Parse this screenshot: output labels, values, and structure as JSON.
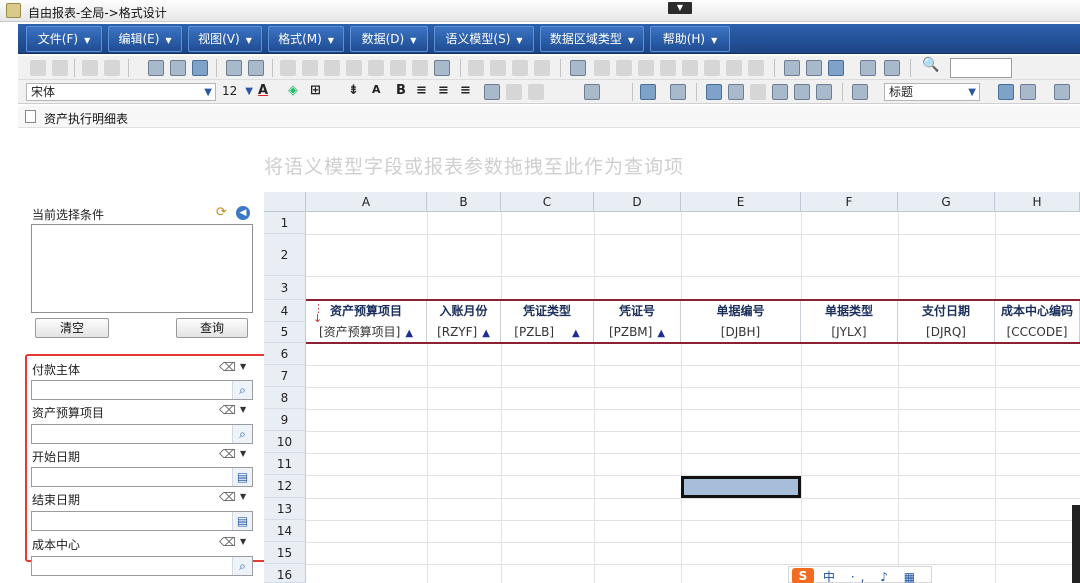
{
  "window": {
    "title": "自由报表-全局->格式设计"
  },
  "menu": [
    {
      "label": "文件(F)"
    },
    {
      "label": "编辑(E)"
    },
    {
      "label": "视图(V)"
    },
    {
      "label": "格式(M)"
    },
    {
      "label": "数据(D)"
    },
    {
      "label": "语义模型(S)"
    },
    {
      "label": "数据区域类型"
    },
    {
      "label": "帮助(H)"
    }
  ],
  "toolbar": {
    "font_name": "宋体",
    "font_size": "12",
    "style_name": "标题"
  },
  "document_tab": {
    "label": "资产执行明细表"
  },
  "drop_hint": "将语义模型字段或报表参数拖拽至此作为查询项",
  "condition_panel": {
    "label": "当前选择条件",
    "clear_button": "清空",
    "query_button": "查询"
  },
  "filters": [
    {
      "label": "付款主体",
      "button": "search-icon"
    },
    {
      "label": "资产预算项目",
      "button": "search-icon"
    },
    {
      "label": "开始日期",
      "button": "calendar-icon"
    },
    {
      "label": "结束日期",
      "button": "calendar-icon"
    },
    {
      "label": "成本中心",
      "button": "search-icon"
    }
  ],
  "sheet": {
    "columns": [
      "A",
      "B",
      "C",
      "D",
      "E",
      "F",
      "G",
      "H"
    ],
    "rows": [
      "1",
      "2",
      "3",
      "4",
      "5",
      "6",
      "7",
      "8",
      "9",
      "10",
      "11",
      "12",
      "13",
      "14",
      "15",
      "16"
    ],
    "header_row": [
      "资产预算项目",
      "入账月份",
      "凭证类型",
      "凭证号",
      "单据编号",
      "单据类型",
      "支付日期",
      "成本中心编码"
    ],
    "field_row": [
      "[资产预算项目]",
      "[RZYF]",
      "[PZLB]",
      "[PZBM]",
      "[DJBH]",
      "[JYLX]",
      "[DJRQ]",
      "[CCCODE]"
    ],
    "field_row_sort_markers": [
      true,
      true,
      true,
      true,
      false,
      false,
      false,
      false
    ],
    "selected_cell": "E12",
    "colors": {
      "band": "#8a2233",
      "selection_fill": "#a7bedb",
      "header_text": "#1b2f5c"
    }
  },
  "ime": {
    "logo": "S",
    "text": "中 ·, ♪ ▦ ⁘"
  }
}
